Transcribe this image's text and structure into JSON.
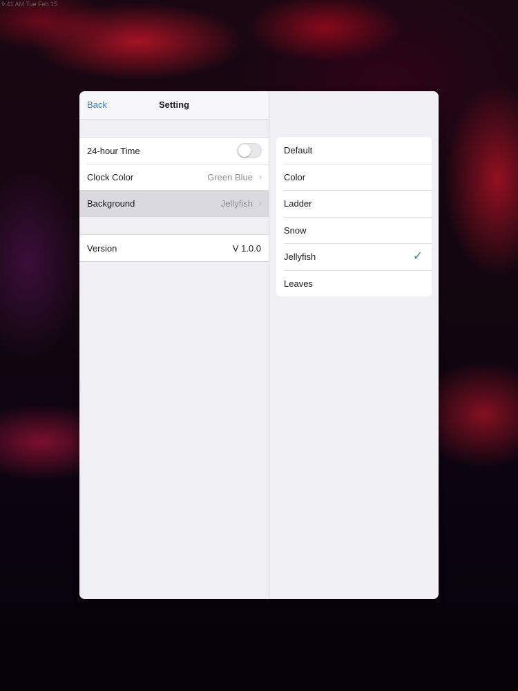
{
  "status_bar": {
    "text": "9:41 AM  Tue Feb 15"
  },
  "master": {
    "back_label": "Back",
    "title": "Setting",
    "settings": [
      {
        "label": "24-hour Time",
        "type": "toggle",
        "on": false
      },
      {
        "label": "Clock Color",
        "value": "Green Blue"
      },
      {
        "label": "Background",
        "value": "Jellyfish",
        "selected": true
      }
    ],
    "info": [
      {
        "label": "Version",
        "value": "V 1.0.0"
      }
    ]
  },
  "detail": {
    "options": [
      {
        "label": "Default"
      },
      {
        "label": "Color"
      },
      {
        "label": "Ladder"
      },
      {
        "label": "Snow"
      },
      {
        "label": "Jellyfish",
        "checked": true
      },
      {
        "label": "Leaves"
      }
    ]
  },
  "colors": {
    "accent": "#2f7fd6",
    "panel_bg": "#efeff4",
    "selected_row": "#d9d9df"
  },
  "icons": {
    "chevron": "chevron-right-icon",
    "check": "checkmark-icon"
  }
}
